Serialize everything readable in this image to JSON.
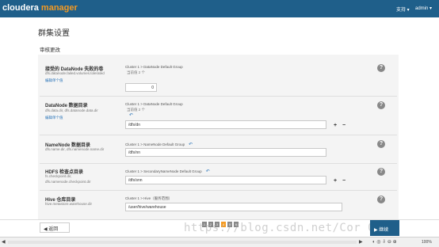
{
  "header": {
    "logo_brand": "cloudera",
    "logo_product": "manager",
    "support_label": "支持 ▾",
    "user_label": "admin ▾"
  },
  "page": {
    "title": "群集设置",
    "section_title": "审核更改"
  },
  "properties": [
    {
      "name": "接受的 DataNode 失败的卷",
      "key": "dfs.datanode.failed.volumes.tolerated",
      "edit_link": "编辑单个值",
      "scope": "Cluster 1 > DataNode Default Group",
      "changed_note": "当前值 2 个",
      "value": "0"
    },
    {
      "name": "DataNode 数据目录",
      "key": "dfs.data.dir, dfs.datanode.data.dir",
      "edit_link": "编辑单个值",
      "scope": "Cluster 1 > DataNode Default Group",
      "changed_note": "当前值 2 个",
      "value": "/dfs/dn"
    },
    {
      "name": "NameNode 数据目录",
      "key": "dfs.name.dir, dfs.namenode.name.dir",
      "scope": "Cluster 1 > NameNode Default Group",
      "value": "/dfs/nn"
    },
    {
      "name": "HDFS 检查点目录",
      "key": "fs.checkpoint.dir,",
      "key2": "dfs.namenode.checkpoint.dir",
      "scope": "Cluster 1 > SecondaryNameNode Default Group",
      "value": "/dfs/snn"
    },
    {
      "name": "Hive 仓库目录",
      "key": "hive.metastore.warehouse.dir",
      "scope": "Cluster 1 > Hive（服务范围）",
      "value": "/user/hive/warehouse"
    }
  ],
  "icons": {
    "undo": "↶",
    "help": "?",
    "plus": "+",
    "minus": "−"
  },
  "footer": {
    "back_label": "◀ 返回",
    "continue_label": "▶ 继续",
    "pages": [
      "1",
      "2",
      "3",
      "4",
      "5",
      "6"
    ],
    "active_page": 4
  },
  "watermark": "https://blog.csdn.net/Cor  0415",
  "statusbar": {
    "zoom": "100%"
  },
  "colors": {
    "topbar": "#1f5f8a",
    "accent": "#f49a22",
    "link": "#2a74b8"
  }
}
